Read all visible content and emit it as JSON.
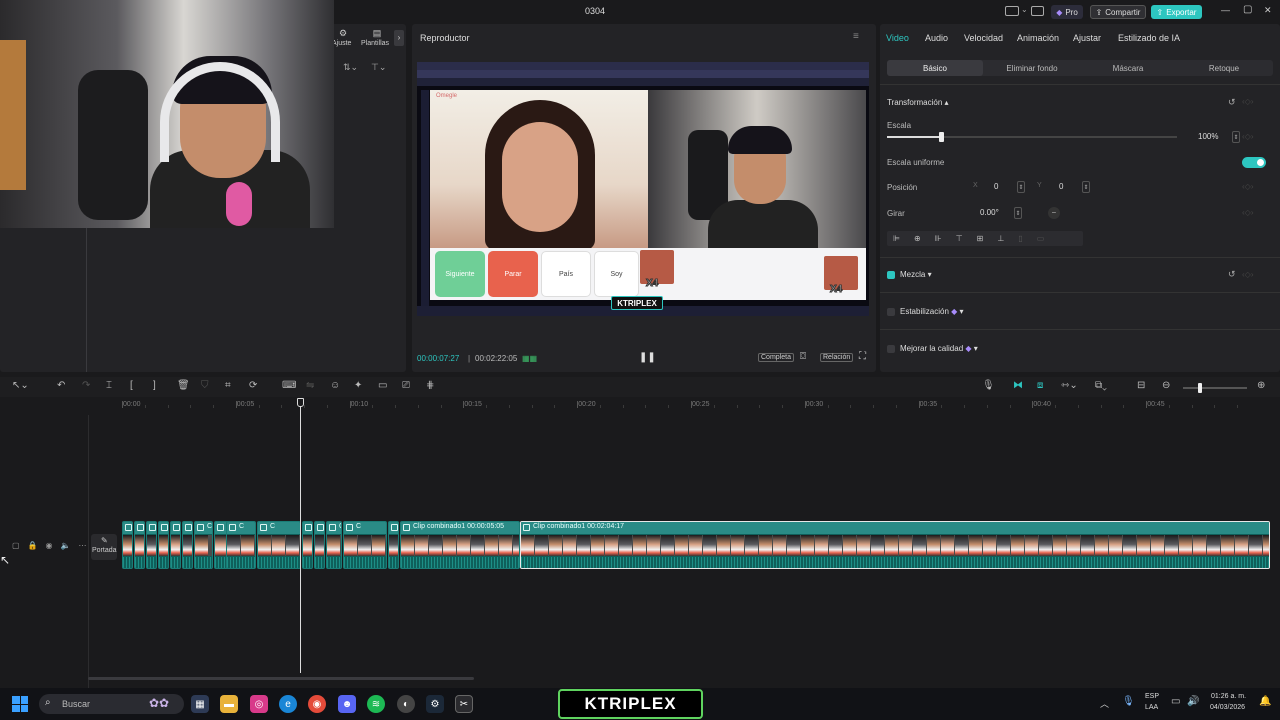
{
  "window": {
    "title": "0304",
    "pro_label": "Pro",
    "share_label": "Compartir",
    "export_label": "Exportar",
    "minimize": "—",
    "maximize": "▢",
    "close": "✕"
  },
  "left_panel": {
    "tab_adjust": "Ajuste",
    "tab_templates": "Plantillas"
  },
  "player": {
    "title": "Reproductor",
    "current_time": "00:00:07:27",
    "total_time": "00:02:22:05",
    "full_label": "Completa",
    "ratio_label": "Relación",
    "video_content": {
      "btn_next": "Siguiente",
      "btn_stop": "Parar",
      "btn_country": "País",
      "btn_soy": "Soy",
      "sticker": "X4",
      "mini_text": "Omegle",
      "watermark": "KTRIPLEX"
    }
  },
  "inspector": {
    "tabs": [
      "Video",
      "Audio",
      "Velocidad",
      "Animación",
      "Ajustar",
      "Estilizado de IA"
    ],
    "active_tab": "Video",
    "subtabs": [
      "Básico",
      "Eliminar fondo",
      "Máscara",
      "Retoque"
    ],
    "active_subtab": "Básico",
    "transform_label": "Transformación",
    "scale_label": "Escala",
    "scale_value": "100%",
    "scale_fraction": 0.5,
    "uniform_label": "Escala uniforme",
    "position_label": "Posición",
    "pos_x_label": "X",
    "pos_x": "0",
    "pos_y_label": "Y",
    "pos_y": "0",
    "rotate_label": "Girar",
    "rotate_value": "0.00°",
    "blend_label": "Mezcla",
    "stabilize_label": "Estabilización",
    "enhance_label": "Mejorar la calidad"
  },
  "timeline": {
    "ticks": [
      "00:00",
      "00:05",
      "00:10",
      "00:15",
      "00:20",
      "00:25",
      "00:30",
      "00:35",
      "00:40",
      "00:45"
    ],
    "cover_label": "Portada",
    "clips": [
      {
        "label": "Cli"
      },
      {
        "label": "C"
      },
      {
        "label": "C"
      },
      {
        "label": "C"
      },
      {
        "label": "C"
      },
      {
        "label": "Cli"
      },
      {
        "label": "C"
      },
      {
        "label": "Clip co"
      },
      {
        "label": "C"
      },
      {
        "label": "C"
      },
      {
        "label": "C"
      },
      {
        "label": "C"
      },
      {
        "label": "Clip com"
      },
      {
        "label": "C"
      },
      {
        "label": "C"
      },
      {
        "label": "Clip combinado1  00:00:05:05"
      },
      {
        "label": "Clip combinado1  00:02:04:17"
      }
    ]
  },
  "taskbar": {
    "search_placeholder": "Buscar",
    "lang_top": "ESP",
    "lang_bottom": "LAA",
    "time": "01:26 a. m.",
    "date": "04/03/2026",
    "brand": "KTRIPLEX"
  },
  "colors": {
    "accent": "#2dc6c0",
    "bg": "#1a1a1c",
    "panel": "#232326",
    "clip_header": "#2a8b86",
    "btn_green": "#6fcf97",
    "btn_red": "#e8624d"
  }
}
